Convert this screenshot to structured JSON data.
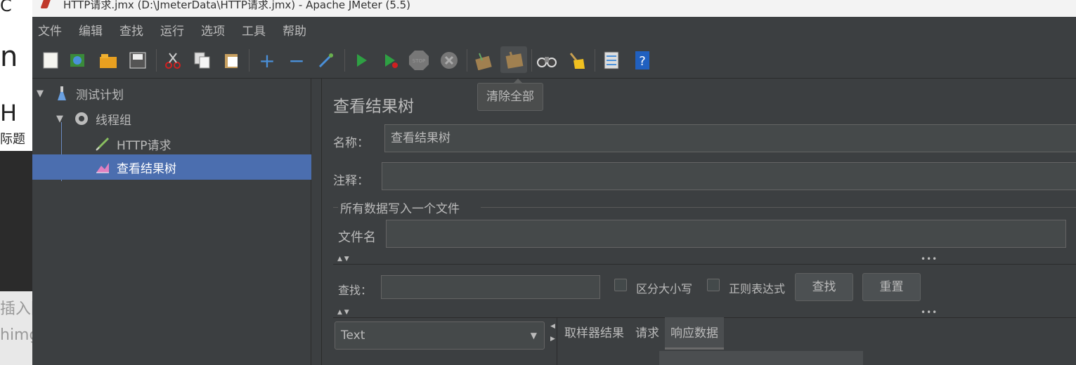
{
  "window": {
    "title": "HTTP请求.jmx (D:\\JmeterData\\HTTP请求.jmx) - Apache JMeter (5.5)"
  },
  "bg_window": {
    "texts": [
      "C",
      "n",
      "H",
      "际题",
      "插入图",
      "himg"
    ]
  },
  "menu": [
    "文件",
    "编辑",
    "查找",
    "运行",
    "选项",
    "工具",
    "帮助"
  ],
  "toolbar": {
    "icons": [
      "new-icon",
      "templates-icon",
      "open-icon",
      "save-icon",
      "cut-icon",
      "copy-icon",
      "paste-icon",
      "expand-icon",
      "collapse-icon",
      "toggle-icon",
      "start-icon",
      "start-no-pause-icon",
      "stop-icon",
      "shutdown-icon",
      "clear-icon",
      "clear-all-icon",
      "search-icon",
      "reset-search-icon",
      "function-helper-icon",
      "help-icon"
    ],
    "tooltip": "清除全部"
  },
  "tree": {
    "items": [
      {
        "label": "测试计划",
        "icon": "test-plan-icon"
      },
      {
        "label": "线程组",
        "icon": "thread-group-icon"
      },
      {
        "label": "HTTP请求",
        "icon": "sampler-icon"
      },
      {
        "label": "查看结果树",
        "icon": "listener-icon"
      }
    ]
  },
  "panel": {
    "title": "查看结果树",
    "name_label": "名称：",
    "name_value": "查看结果树",
    "comment_label": "注释：",
    "comment_value": "",
    "group_title": "所有数据写入一个文件",
    "filename_label": "文件名",
    "filename_value": "",
    "search_label": "查找：",
    "search_value": "",
    "case_label": "区分大小写",
    "regex_label": "正则表达式",
    "find_button": "查找",
    "reset_button": "重置",
    "renderer_selected": "Text",
    "tabs": [
      "取样器结果",
      "请求",
      "响应数据"
    ]
  }
}
